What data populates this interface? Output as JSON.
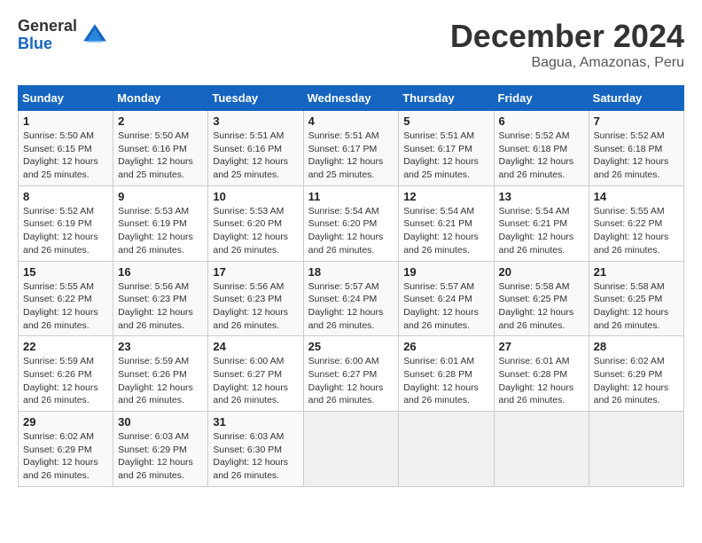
{
  "logo": {
    "general": "General",
    "blue": "Blue"
  },
  "title": "December 2024",
  "location": "Bagua, Amazonas, Peru",
  "days_of_week": [
    "Sunday",
    "Monday",
    "Tuesday",
    "Wednesday",
    "Thursday",
    "Friday",
    "Saturday"
  ],
  "weeks": [
    [
      {
        "day": "1",
        "detail": "Sunrise: 5:50 AM\nSunset: 6:15 PM\nDaylight: 12 hours\nand 25 minutes."
      },
      {
        "day": "2",
        "detail": "Sunrise: 5:50 AM\nSunset: 6:16 PM\nDaylight: 12 hours\nand 25 minutes."
      },
      {
        "day": "3",
        "detail": "Sunrise: 5:51 AM\nSunset: 6:16 PM\nDaylight: 12 hours\nand 25 minutes."
      },
      {
        "day": "4",
        "detail": "Sunrise: 5:51 AM\nSunset: 6:17 PM\nDaylight: 12 hours\nand 25 minutes."
      },
      {
        "day": "5",
        "detail": "Sunrise: 5:51 AM\nSunset: 6:17 PM\nDaylight: 12 hours\nand 25 minutes."
      },
      {
        "day": "6",
        "detail": "Sunrise: 5:52 AM\nSunset: 6:18 PM\nDaylight: 12 hours\nand 26 minutes."
      },
      {
        "day": "7",
        "detail": "Sunrise: 5:52 AM\nSunset: 6:18 PM\nDaylight: 12 hours\nand 26 minutes."
      }
    ],
    [
      {
        "day": "8",
        "detail": "Sunrise: 5:52 AM\nSunset: 6:19 PM\nDaylight: 12 hours\nand 26 minutes."
      },
      {
        "day": "9",
        "detail": "Sunrise: 5:53 AM\nSunset: 6:19 PM\nDaylight: 12 hours\nand 26 minutes."
      },
      {
        "day": "10",
        "detail": "Sunrise: 5:53 AM\nSunset: 6:20 PM\nDaylight: 12 hours\nand 26 minutes."
      },
      {
        "day": "11",
        "detail": "Sunrise: 5:54 AM\nSunset: 6:20 PM\nDaylight: 12 hours\nand 26 minutes."
      },
      {
        "day": "12",
        "detail": "Sunrise: 5:54 AM\nSunset: 6:21 PM\nDaylight: 12 hours\nand 26 minutes."
      },
      {
        "day": "13",
        "detail": "Sunrise: 5:54 AM\nSunset: 6:21 PM\nDaylight: 12 hours\nand 26 minutes."
      },
      {
        "day": "14",
        "detail": "Sunrise: 5:55 AM\nSunset: 6:22 PM\nDaylight: 12 hours\nand 26 minutes."
      }
    ],
    [
      {
        "day": "15",
        "detail": "Sunrise: 5:55 AM\nSunset: 6:22 PM\nDaylight: 12 hours\nand 26 minutes."
      },
      {
        "day": "16",
        "detail": "Sunrise: 5:56 AM\nSunset: 6:23 PM\nDaylight: 12 hours\nand 26 minutes."
      },
      {
        "day": "17",
        "detail": "Sunrise: 5:56 AM\nSunset: 6:23 PM\nDaylight: 12 hours\nand 26 minutes."
      },
      {
        "day": "18",
        "detail": "Sunrise: 5:57 AM\nSunset: 6:24 PM\nDaylight: 12 hours\nand 26 minutes."
      },
      {
        "day": "19",
        "detail": "Sunrise: 5:57 AM\nSunset: 6:24 PM\nDaylight: 12 hours\nand 26 minutes."
      },
      {
        "day": "20",
        "detail": "Sunrise: 5:58 AM\nSunset: 6:25 PM\nDaylight: 12 hours\nand 26 minutes."
      },
      {
        "day": "21",
        "detail": "Sunrise: 5:58 AM\nSunset: 6:25 PM\nDaylight: 12 hours\nand 26 minutes."
      }
    ],
    [
      {
        "day": "22",
        "detail": "Sunrise: 5:59 AM\nSunset: 6:26 PM\nDaylight: 12 hours\nand 26 minutes."
      },
      {
        "day": "23",
        "detail": "Sunrise: 5:59 AM\nSunset: 6:26 PM\nDaylight: 12 hours\nand 26 minutes."
      },
      {
        "day": "24",
        "detail": "Sunrise: 6:00 AM\nSunset: 6:27 PM\nDaylight: 12 hours\nand 26 minutes."
      },
      {
        "day": "25",
        "detail": "Sunrise: 6:00 AM\nSunset: 6:27 PM\nDaylight: 12 hours\nand 26 minutes."
      },
      {
        "day": "26",
        "detail": "Sunrise: 6:01 AM\nSunset: 6:28 PM\nDaylight: 12 hours\nand 26 minutes."
      },
      {
        "day": "27",
        "detail": "Sunrise: 6:01 AM\nSunset: 6:28 PM\nDaylight: 12 hours\nand 26 minutes."
      },
      {
        "day": "28",
        "detail": "Sunrise: 6:02 AM\nSunset: 6:29 PM\nDaylight: 12 hours\nand 26 minutes."
      }
    ],
    [
      {
        "day": "29",
        "detail": "Sunrise: 6:02 AM\nSunset: 6:29 PM\nDaylight: 12 hours\nand 26 minutes."
      },
      {
        "day": "30",
        "detail": "Sunrise: 6:03 AM\nSunset: 6:29 PM\nDaylight: 12 hours\nand 26 minutes."
      },
      {
        "day": "31",
        "detail": "Sunrise: 6:03 AM\nSunset: 6:30 PM\nDaylight: 12 hours\nand 26 minutes."
      },
      {
        "day": "",
        "detail": ""
      },
      {
        "day": "",
        "detail": ""
      },
      {
        "day": "",
        "detail": ""
      },
      {
        "day": "",
        "detail": ""
      }
    ]
  ]
}
